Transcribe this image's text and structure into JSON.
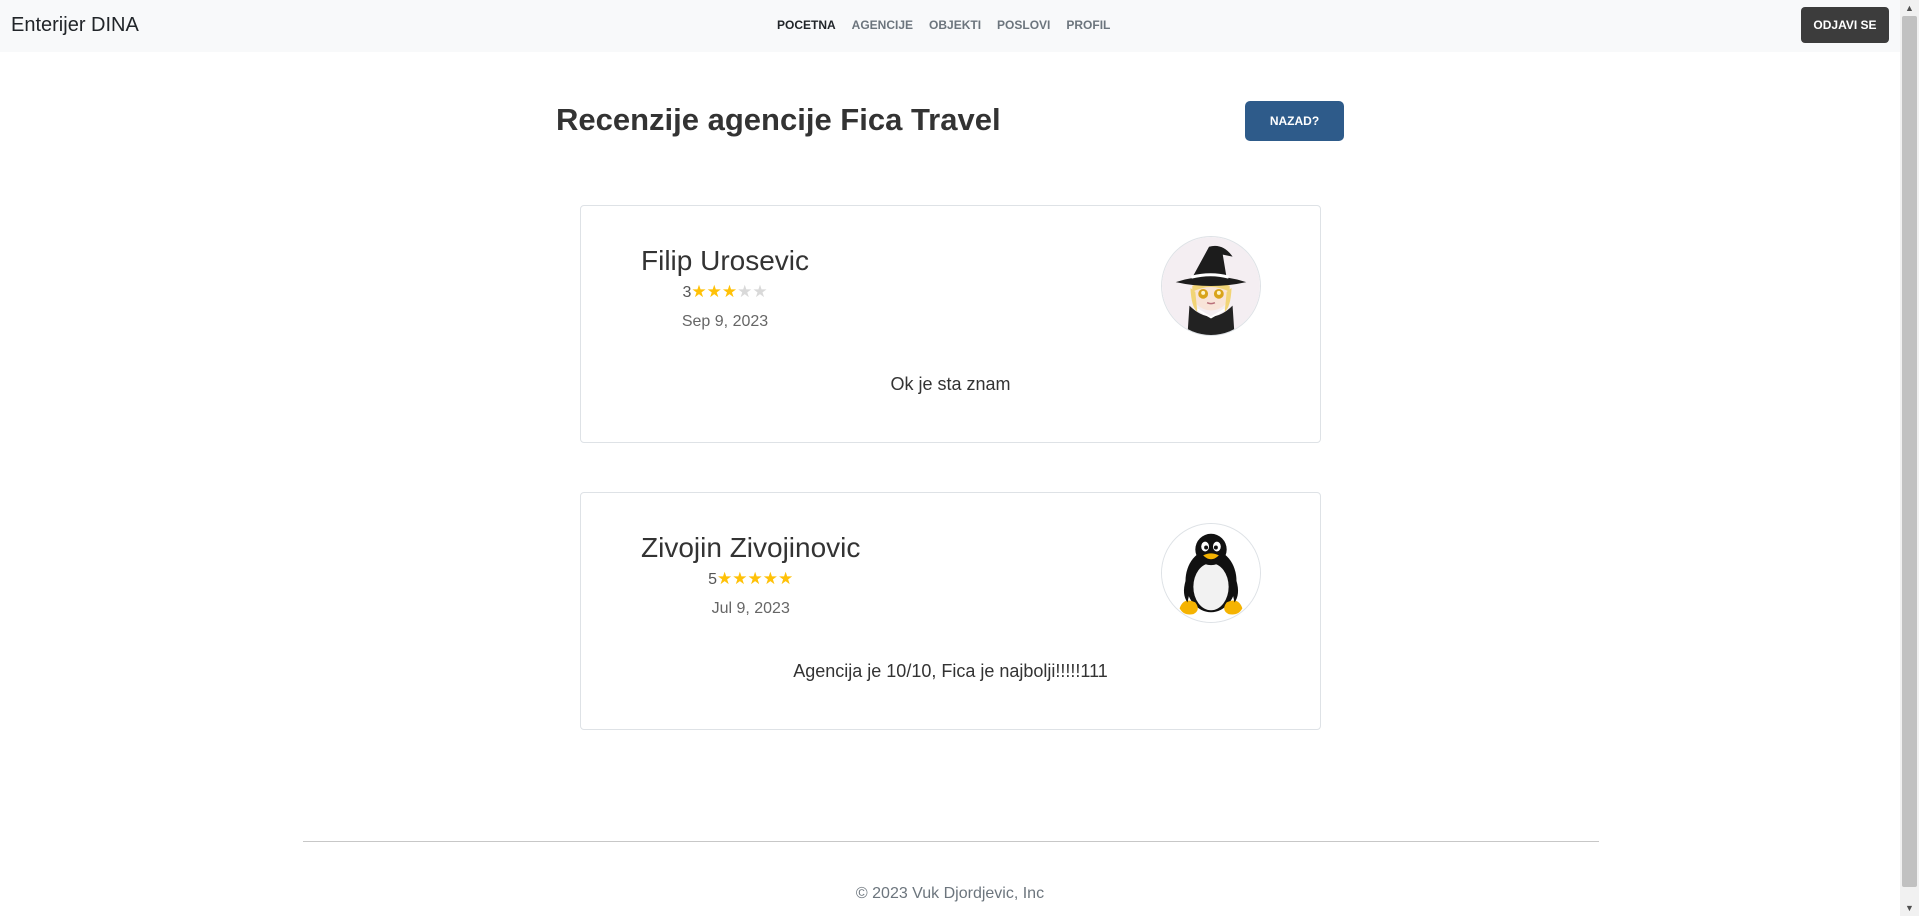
{
  "navbar": {
    "brand": "Enterijer DINA",
    "links": [
      {
        "label": "POCETNA",
        "active": true
      },
      {
        "label": "AGENCIJE",
        "active": false
      },
      {
        "label": "OBJEKTI",
        "active": false
      },
      {
        "label": "POSLOVI",
        "active": false
      },
      {
        "label": "PROFIL",
        "active": false
      }
    ],
    "logout_label": "ODJAVI SE"
  },
  "page": {
    "title": "Recenzije agencije Fica Travel",
    "back_label": "NAZAD?"
  },
  "reviews": [
    {
      "name": "Filip Urosevic",
      "rating": 3,
      "max_rating": 5,
      "date": "Sep 9, 2023",
      "text": "Ok je sta znam",
      "avatar": "witch-anime-avatar"
    },
    {
      "name": "Zivojin Zivojinovic",
      "rating": 5,
      "max_rating": 5,
      "date": "Jul 9, 2023",
      "text": "Agencija je 10/10, Fica je najbolji!!!!!111",
      "avatar": "tux-penguin-avatar"
    }
  ],
  "footer": {
    "text": "© 2023 Vuk Djordjevic, Inc"
  },
  "colors": {
    "star_filled": "#ffc107",
    "star_empty": "#d9d9d9",
    "back_button": "#2e5b8a",
    "logout_button": "#3c3c3c",
    "navbar_bg": "#f8f9fa"
  }
}
